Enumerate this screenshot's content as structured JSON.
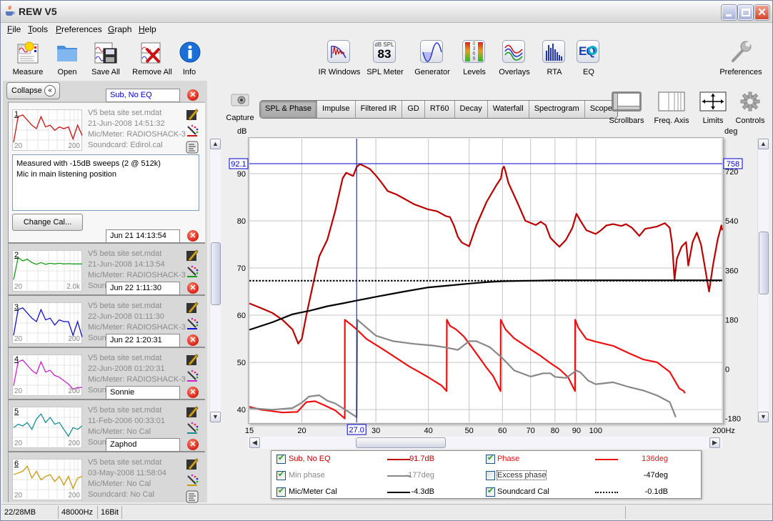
{
  "window": {
    "title": "REW V5"
  },
  "menu": [
    "File",
    "Tools",
    "Preferences",
    "Graph",
    "Help"
  ],
  "toolbar_left": [
    {
      "label": "Measure",
      "icon": "measure-icon"
    },
    {
      "label": "Open",
      "icon": "folder-icon"
    },
    {
      "label": "Save All",
      "icon": "save-all-icon"
    },
    {
      "label": "Remove All",
      "icon": "remove-all-icon"
    },
    {
      "label": "Info",
      "icon": "info-icon"
    }
  ],
  "toolbar_center": [
    {
      "label": "IR Windows",
      "icon": "ir-windows-icon"
    },
    {
      "label": "SPL Meter",
      "icon": "spl-meter-icon",
      "badge_top": "dB SPL",
      "badge_value": "83"
    },
    {
      "label": "Generator",
      "icon": "generator-icon"
    },
    {
      "label": "Levels",
      "icon": "levels-icon",
      "badge_digits": "0 3 6 9"
    },
    {
      "label": "Overlays",
      "icon": "overlays-icon"
    },
    {
      "label": "RTA",
      "icon": "rta-icon"
    },
    {
      "label": "EQ",
      "icon": "eq-icon",
      "badge_text": "EQ"
    }
  ],
  "toolbar_right": {
    "label": "Preferences",
    "icon": "wrench-icon"
  },
  "left_panel": {
    "collapse_label": "Collapse",
    "notes": "Measured with -15dB sweeps (2 @ 512k)\nMic in main listening position",
    "change_cal_label": "Change Cal...",
    "measurements": [
      {
        "num": "1",
        "name": "Sub, No EQ",
        "file": "V5 beta site set.mdat",
        "date": "21-Jun-2008 14:51:32",
        "mic": "Mic/Meter: RADIOSHACK-3",
        "soundcard": "Soundcard: Edirol.cal",
        "color": "#cc1111",
        "x_start": "20",
        "x_end": "200"
      },
      {
        "num": "2",
        "name": "Jun 21 14:13:54",
        "file": "V5 beta site set.mdat",
        "date": "21-Jun-2008 14:13:54",
        "mic": "Mic/Meter: RADIOSHACK-3",
        "soundcard": "Soundcard: Edirol.cal",
        "color": "#1a9a1a",
        "x_start": "20",
        "x_end": "2.0k"
      },
      {
        "num": "3",
        "name": "Jun 22 1:11:30",
        "file": "V5 beta site set.mdat",
        "date": "22-Jun-2008 01:11:30",
        "mic": "Mic/Meter: RADIOSHACK-3",
        "soundcard": "Soundcard: Edirol.cal",
        "color": "#1111cc",
        "x_start": "20",
        "x_end": "200"
      },
      {
        "num": "4",
        "name": "Jun 22 1:20:31",
        "file": "V5 beta site set.mdat",
        "date": "22-Jun-2008 01:20:31",
        "mic": "Mic/Meter: RADIOSHACK-3",
        "soundcard": "Soundcard: Edirol.cal",
        "color": "#cc22cc",
        "x_start": "20",
        "x_end": "200"
      },
      {
        "num": "5",
        "name": "Sonnie",
        "file": "V5 beta site set.mdat",
        "date": "11-Feb-2006 00:33:01",
        "mic": "Mic/Meter: No Cal",
        "soundcard": "Soundcard: No Cal",
        "color": "#159090",
        "x_start": "20",
        "x_end": "200"
      },
      {
        "num": "6",
        "name": "Zaphod",
        "file": "V5 beta site set.mdat",
        "date": "03-May-2008 11:58:04",
        "mic": "Mic/Meter: No Cal",
        "soundcard": "Soundcard: No Cal",
        "color": "#c89a10",
        "x_start": "20",
        "x_end": "200"
      }
    ]
  },
  "graph_tabs": [
    {
      "label": "SPL & Phase",
      "active": true
    },
    {
      "label": "Impulse"
    },
    {
      "label": "Filtered IR"
    },
    {
      "label": "GD"
    },
    {
      "label": "RT60"
    },
    {
      "label": "Decay"
    },
    {
      "label": "Waterfall"
    },
    {
      "label": "Spectrogram"
    },
    {
      "label": "Scope"
    }
  ],
  "capture_label": "Capture",
  "graph_tools": [
    {
      "label": "Scrollbars",
      "icon": "scrollbars-icon"
    },
    {
      "label": "Freq. Axis",
      "icon": "freq-axis-icon"
    },
    {
      "label": "Limits",
      "icon": "limits-icon"
    },
    {
      "label": "Controls",
      "icon": "gear-icon"
    }
  ],
  "chart_data": {
    "type": "line",
    "title": "SPL & Phase",
    "xlabel": "Hz",
    "x_scale": "log",
    "xlim": [
      15,
      200
    ],
    "x_ticks": [
      "15",
      "20",
      "30",
      "40",
      "50",
      "60",
      "70",
      "80",
      "90",
      "100",
      "200Hz"
    ],
    "y_left_label": "dB",
    "ylim_left": [
      37.3,
      97.4
    ],
    "y_left_ticks": [
      "40",
      "50",
      "60",
      "70",
      "80",
      "90"
    ],
    "y_right_label": "deg",
    "ylim_right": [
      -194,
      840
    ],
    "y_right_ticks": [
      "-180",
      "0",
      "180",
      "360",
      "540",
      "720"
    ],
    "grid": true,
    "cursor": {
      "x": "27.0",
      "y_left": "92.1",
      "y_right": "758"
    },
    "series": [
      {
        "name": "Sub, No EQ",
        "axis": "left",
        "color": "#bb0000",
        "style": "solid",
        "points": [
          [
            15,
            62.5
          ],
          [
            16,
            61.5
          ],
          [
            17,
            60.5
          ],
          [
            18,
            59
          ],
          [
            19,
            57
          ],
          [
            19.6,
            54
          ],
          [
            20,
            55
          ],
          [
            20.5,
            60
          ],
          [
            21.2,
            66
          ],
          [
            22,
            72.5
          ],
          [
            23,
            76
          ],
          [
            24,
            82
          ],
          [
            25,
            89
          ],
          [
            25.5,
            90.2
          ],
          [
            26,
            89.8
          ],
          [
            26.5,
            89.5
          ],
          [
            27,
            91.4
          ],
          [
            27.5,
            92
          ],
          [
            28,
            91.7
          ],
          [
            29,
            91
          ],
          [
            30,
            89.6
          ],
          [
            31,
            88
          ],
          [
            32,
            86.3
          ],
          [
            33.5,
            85.6
          ],
          [
            35,
            84.7
          ],
          [
            37,
            83.5
          ],
          [
            40,
            82.4
          ],
          [
            42,
            82
          ],
          [
            44,
            81
          ],
          [
            45,
            80.8
          ],
          [
            46,
            79
          ],
          [
            47,
            76.6
          ],
          [
            48,
            75.4
          ],
          [
            50,
            74.6
          ],
          [
            52,
            79
          ],
          [
            55,
            84
          ],
          [
            58,
            87.5
          ],
          [
            59.5,
            89
          ],
          [
            60,
            91
          ],
          [
            60.5,
            91.5
          ],
          [
            61,
            90.5
          ],
          [
            62,
            88
          ],
          [
            65,
            84
          ],
          [
            68,
            80
          ],
          [
            72,
            79.1
          ],
          [
            74,
            79.8
          ],
          [
            76,
            79.1
          ],
          [
            78,
            76.4
          ],
          [
            80,
            75.4
          ],
          [
            82,
            74.5
          ],
          [
            85,
            76
          ],
          [
            88,
            78.5
          ],
          [
            90,
            81.5
          ],
          [
            92,
            80
          ],
          [
            95,
            78
          ],
          [
            100,
            77.2
          ],
          [
            103,
            78
          ],
          [
            106,
            79
          ],
          [
            110,
            79.3
          ],
          [
            115,
            78.9
          ],
          [
            118,
            79.3
          ],
          [
            122,
            78.5
          ],
          [
            127,
            76.8
          ],
          [
            131,
            78.3
          ],
          [
            135,
            78.5
          ],
          [
            140,
            78.8
          ],
          [
            146,
            79.5
          ],
          [
            150,
            78.5
          ],
          [
            152,
            75
          ],
          [
            154,
            67.5
          ],
          [
            156,
            72
          ],
          [
            160,
            74.5
          ],
          [
            164,
            75.5
          ],
          [
            166,
            70.5
          ],
          [
            170,
            75.5
          ],
          [
            174,
            77.5
          ],
          [
            178,
            75
          ],
          [
            182,
            70
          ],
          [
            186,
            65
          ],
          [
            190,
            70.5
          ],
          [
            195,
            76
          ],
          [
            199,
            79
          ],
          [
            200,
            78
          ]
        ]
      },
      {
        "name": "Phase",
        "axis": "right",
        "color": "#ee1111",
        "style": "solid",
        "points": [
          [
            15,
            -137
          ],
          [
            16,
            -148
          ],
          [
            18,
            -158
          ],
          [
            19.5,
            -156
          ],
          [
            20.5,
            -120
          ],
          [
            21.5,
            -117
          ],
          [
            22.5,
            -130
          ],
          [
            24,
            -150
          ],
          [
            25.3,
            -180
          ],
          [
            25.31,
            180
          ],
          [
            26.3,
            160
          ],
          [
            27,
            145
          ],
          [
            28.5,
            110
          ],
          [
            31,
            75
          ],
          [
            34,
            35
          ],
          [
            36,
            10
          ],
          [
            38,
            -10
          ],
          [
            40,
            -30
          ],
          [
            43,
            -60
          ],
          [
            44.2,
            -80
          ],
          [
            44.25,
            180
          ],
          [
            45,
            158
          ],
          [
            46.5,
            145
          ],
          [
            48.5,
            120
          ],
          [
            51,
            75
          ],
          [
            53,
            40
          ],
          [
            55,
            5
          ],
          [
            57,
            -25
          ],
          [
            59.4,
            -80
          ],
          [
            59.45,
            180
          ],
          [
            61,
            145
          ],
          [
            64,
            112
          ],
          [
            67,
            92
          ],
          [
            70,
            72
          ],
          [
            74,
            48
          ],
          [
            78,
            22
          ],
          [
            82,
            0
          ],
          [
            86,
            -30
          ],
          [
            89.3,
            -80
          ],
          [
            89.35,
            180
          ],
          [
            91,
            150
          ],
          [
            95,
            110
          ],
          [
            100,
            100
          ],
          [
            110,
            85
          ],
          [
            120,
            58
          ],
          [
            130,
            35
          ],
          [
            140,
            25
          ],
          [
            150,
            -10
          ],
          [
            158,
            -70
          ],
          [
            162,
            -80
          ],
          [
            163,
            -88
          ]
        ]
      },
      {
        "name": "Min phase",
        "axis": "right",
        "color": "#888888",
        "style": "solid",
        "points": [
          [
            15,
            -142
          ],
          [
            17,
            -148
          ],
          [
            19,
            -142
          ],
          [
            20,
            -122
          ],
          [
            20.8,
            -100
          ],
          [
            22,
            -95
          ],
          [
            23,
            -115
          ],
          [
            24,
            -125
          ],
          [
            25.5,
            -150
          ],
          [
            27,
            -175
          ],
          [
            27.1,
            180
          ],
          [
            30,
            122
          ],
          [
            33,
            102
          ],
          [
            37,
            92
          ],
          [
            41,
            86
          ],
          [
            44,
            79
          ],
          [
            47,
            70
          ],
          [
            50,
            102
          ],
          [
            52,
            102
          ],
          [
            56,
            80
          ],
          [
            60,
            40
          ],
          [
            64,
            -5
          ],
          [
            70,
            -27
          ],
          [
            75,
            -15
          ],
          [
            78,
            -15
          ],
          [
            80,
            -28
          ],
          [
            85,
            -32
          ],
          [
            90,
            -5
          ],
          [
            92,
            -12
          ],
          [
            96,
            -42
          ],
          [
            100,
            -55
          ],
          [
            110,
            -48
          ],
          [
            120,
            -65
          ],
          [
            130,
            -78
          ],
          [
            140,
            -96
          ],
          [
            150,
            -120
          ],
          [
            155,
            -175
          ]
        ]
      },
      {
        "name": "Mic/Meter Cal",
        "axis": "left",
        "color": "#000000",
        "style": "solid",
        "points": [
          [
            15,
            56.9
          ],
          [
            17,
            58.5
          ],
          [
            19,
            60.2
          ],
          [
            21,
            61
          ],
          [
            23,
            61.9
          ],
          [
            25,
            62.5
          ],
          [
            27,
            63.1
          ],
          [
            30,
            63.9
          ],
          [
            35,
            65
          ],
          [
            40,
            65.9
          ],
          [
            45,
            66.3
          ],
          [
            50,
            66.7
          ],
          [
            55,
            67
          ],
          [
            60,
            67.2
          ],
          [
            70,
            67.3
          ],
          [
            80,
            67.4
          ],
          [
            100,
            67.4
          ],
          [
            150,
            67.4
          ],
          [
            200,
            67.4
          ]
        ]
      },
      {
        "name": "Soundcard Cal",
        "axis": "left",
        "color": "#000000",
        "style": "dotted",
        "points": [
          [
            15,
            67.3
          ],
          [
            200,
            67.3
          ]
        ]
      }
    ]
  },
  "legend": [
    {
      "name": "Sub, No EQ",
      "checked": true,
      "value": "91.7dB",
      "color": "#bb0000",
      "name_color": "#bb0000",
      "style": "solid"
    },
    {
      "name": "Phase",
      "checked": true,
      "value": "136deg",
      "color": "#ee1111",
      "name_color": "#ee1111",
      "style": "solid"
    },
    {
      "name": "Min phase",
      "checked": true,
      "value": "-177deg",
      "color": "#888888",
      "name_color": "#888888",
      "style": "solid"
    },
    {
      "name": "Excess phase",
      "checked": false,
      "value": "-47deg",
      "color": "",
      "name_color": "#333333",
      "style": "none"
    },
    {
      "name": "Mic/Meter Cal",
      "checked": true,
      "value": "-4.3dB",
      "color": "#000000",
      "name_color": "#000000",
      "style": "solid"
    },
    {
      "name": "Soundcard Cal",
      "checked": true,
      "value": "-0.1dB",
      "color": "#000000",
      "name_color": "#000000",
      "style": "dotted"
    }
  ],
  "status": {
    "memory": "22/28MB",
    "sample_rate": "48000Hz",
    "bit_depth": "16Bit"
  }
}
